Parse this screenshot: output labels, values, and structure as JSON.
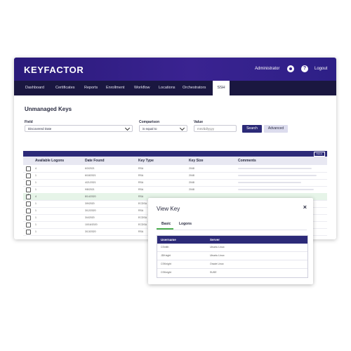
{
  "app": {
    "logo": "KEYFACTOR",
    "user": "Administrator",
    "logout": "Logout",
    "help_glyph": "?"
  },
  "nav": {
    "items": [
      {
        "label": "Dashboard"
      },
      {
        "label": "Certificates"
      },
      {
        "label": "Reports"
      },
      {
        "label": "Enrollment"
      },
      {
        "label": "Workflow"
      },
      {
        "label": "Locations"
      },
      {
        "label": "Orchestrators"
      },
      {
        "label": "SSH"
      }
    ],
    "active": "SSH"
  },
  "page": {
    "title": "Unmanaged Keys",
    "field_label": "Field",
    "field_value": "Discovered Date",
    "comparison_label": "Comparison",
    "comparison_value": "is equal to",
    "value_label": "Value",
    "value_value": "mm/dd/yyyy",
    "search_button": "Search",
    "advanced_button": "Advanced"
  },
  "grid": {
    "toolbar_button": "Delete",
    "columns": [
      "Available Logons",
      "Date Found",
      "Key Type",
      "Key Size",
      "Comments"
    ],
    "rows": [
      {
        "logons": "4",
        "date": "6/3/2021",
        "type": "RSA",
        "size": "2048",
        "checked": false
      },
      {
        "logons": "1",
        "date": "6/18/2021",
        "type": "RSA",
        "size": "2048",
        "checked": false
      },
      {
        "logons": "1",
        "date": "4/21/2021",
        "type": "RSA",
        "size": "2048",
        "checked": false
      },
      {
        "logons": "1",
        "date": "9/8/2021",
        "type": "RSA",
        "size": "2048",
        "checked": false
      },
      {
        "logons": "4",
        "date": "8/14/2020",
        "type": "RSA",
        "size": "2048",
        "checked": true
      },
      {
        "logons": "1",
        "date": "3/9/2020",
        "type": "ECDSA",
        "size": "",
        "checked": false
      },
      {
        "logons": "1",
        "date": "3/12/2020",
        "type": "RSA",
        "size": "",
        "checked": false
      },
      {
        "logons": "1",
        "date": "3/4/2020",
        "type": "ECDSA",
        "size": "",
        "checked": false
      },
      {
        "logons": "1",
        "date": "10/16/2020",
        "type": "ECDSA",
        "size": "",
        "checked": false
      },
      {
        "logons": "1",
        "date": "3/13/2020",
        "type": "RSA",
        "size": "",
        "checked": false
      }
    ]
  },
  "modal": {
    "title": "View Key",
    "close_glyph": "×",
    "tabs": [
      "Basic",
      "Logons"
    ],
    "active_tab": "Basic",
    "columns": [
      "Username",
      "Server"
    ],
    "rows": [
      {
        "username": "CSmith",
        "server": "Ubuntu Linux"
      },
      {
        "username": "JDKnight",
        "server": "Ubuntu Linux"
      },
      {
        "username": "CSKnight",
        "server": "Oracle Linux"
      },
      {
        "username": "CSKnight",
        "server": "SUSE"
      }
    ]
  }
}
